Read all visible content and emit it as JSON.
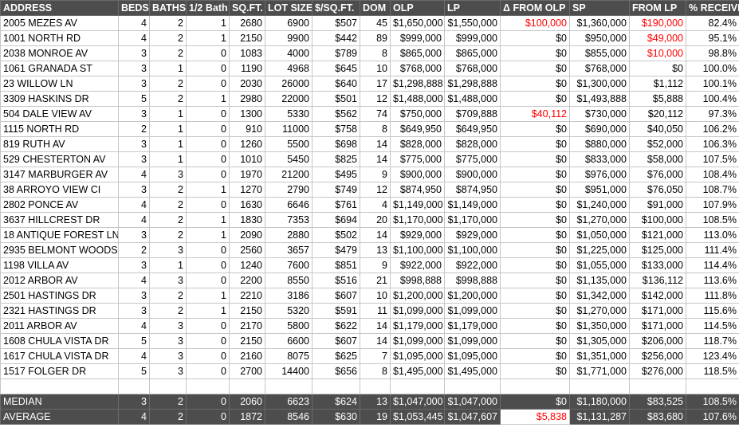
{
  "headers": [
    "ADDRESS",
    "BEDS",
    "BATHS",
    "1/2 Bath",
    "SQ.FT.",
    "LOT SIZE",
    "$/SQ.FT.",
    "DOM",
    "OLP",
    "LP",
    "Δ FROM OLP",
    "SP",
    "FROM LP",
    "% RECEIVED"
  ],
  "rows": [
    [
      "2005 MEZES AV",
      "4",
      "2",
      "1",
      "2680",
      "6900",
      "$507",
      "45",
      "$1,650,000",
      "$1,550,000",
      "$100,000",
      "$1,360,000",
      "$190,000",
      "82.4%"
    ],
    [
      "1001 NORTH RD",
      "4",
      "2",
      "1",
      "2150",
      "9900",
      "$442",
      "89",
      "$999,000",
      "$999,000",
      "$0",
      "$950,000",
      "$49,000",
      "95.1%"
    ],
    [
      "2038 MONROE AV",
      "3",
      "2",
      "0",
      "1083",
      "4000",
      "$789",
      "8",
      "$865,000",
      "$865,000",
      "$0",
      "$855,000",
      "$10,000",
      "98.8%"
    ],
    [
      "1061 GRANADA ST",
      "3",
      "1",
      "0",
      "1190",
      "4968",
      "$645",
      "10",
      "$768,000",
      "$768,000",
      "$0",
      "$768,000",
      "$0",
      "100.0%"
    ],
    [
      "23 WILLOW LN",
      "3",
      "2",
      "0",
      "2030",
      "26000",
      "$640",
      "17",
      "$1,298,888",
      "$1,298,888",
      "$0",
      "$1,300,000",
      "$1,112",
      "100.1%"
    ],
    [
      "3309 HASKINS DR",
      "5",
      "2",
      "1",
      "2980",
      "22000",
      "$501",
      "12",
      "$1,488,000",
      "$1,488,000",
      "$0",
      "$1,493,888",
      "$5,888",
      "100.4%"
    ],
    [
      "504 DALE VIEW AV",
      "3",
      "1",
      "0",
      "1300",
      "5330",
      "$562",
      "74",
      "$750,000",
      "$709,888",
      "$40,112",
      "$730,000",
      "$20,112",
      "97.3%"
    ],
    [
      "1115 NORTH RD",
      "2",
      "1",
      "0",
      "910",
      "11000",
      "$758",
      "8",
      "$649,950",
      "$649,950",
      "$0",
      "$690,000",
      "$40,050",
      "106.2%"
    ],
    [
      "819 RUTH AV",
      "3",
      "1",
      "0",
      "1260",
      "5500",
      "$698",
      "14",
      "$828,000",
      "$828,000",
      "$0",
      "$880,000",
      "$52,000",
      "106.3%"
    ],
    [
      "529 CHESTERTON AV",
      "3",
      "1",
      "0",
      "1010",
      "5450",
      "$825",
      "14",
      "$775,000",
      "$775,000",
      "$0",
      "$833,000",
      "$58,000",
      "107.5%"
    ],
    [
      "3147 MARBURGER AV",
      "4",
      "3",
      "0",
      "1970",
      "21200",
      "$495",
      "9",
      "$900,000",
      "$900,000",
      "$0",
      "$976,000",
      "$76,000",
      "108.4%"
    ],
    [
      "38 ARROYO VIEW CI",
      "3",
      "2",
      "1",
      "1270",
      "2790",
      "$749",
      "12",
      "$874,950",
      "$874,950",
      "$0",
      "$951,000",
      "$76,050",
      "108.7%"
    ],
    [
      "2802 PONCE AV",
      "4",
      "2",
      "0",
      "1630",
      "6646",
      "$761",
      "4",
      "$1,149,000",
      "$1,149,000",
      "$0",
      "$1,240,000",
      "$91,000",
      "107.9%"
    ],
    [
      "3637 HILLCREST DR",
      "4",
      "2",
      "1",
      "1830",
      "7353",
      "$694",
      "20",
      "$1,170,000",
      "$1,170,000",
      "$0",
      "$1,270,000",
      "$100,000",
      "108.5%"
    ],
    [
      "18 ANTIQUE FOREST LN",
      "3",
      "2",
      "1",
      "2090",
      "2880",
      "$502",
      "14",
      "$929,000",
      "$929,000",
      "$0",
      "$1,050,000",
      "$121,000",
      "113.0%"
    ],
    [
      "2935 BELMONT WOODS",
      "2",
      "3",
      "0",
      "2560",
      "3657",
      "$479",
      "13",
      "$1,100,000",
      "$1,100,000",
      "$0",
      "$1,225,000",
      "$125,000",
      "111.4%"
    ],
    [
      "1198 VILLA AV",
      "3",
      "1",
      "0",
      "1240",
      "7600",
      "$851",
      "9",
      "$922,000",
      "$922,000",
      "$0",
      "$1,055,000",
      "$133,000",
      "114.4%"
    ],
    [
      "2012 ARBOR AV",
      "4",
      "3",
      "0",
      "2200",
      "8550",
      "$516",
      "21",
      "$998,888",
      "$998,888",
      "$0",
      "$1,135,000",
      "$136,112",
      "113.6%"
    ],
    [
      "2501 HASTINGS DR",
      "3",
      "2",
      "1",
      "2210",
      "3186",
      "$607",
      "10",
      "$1,200,000",
      "$1,200,000",
      "$0",
      "$1,342,000",
      "$142,000",
      "111.8%"
    ],
    [
      "2321 HASTINGS DR",
      "3",
      "2",
      "1",
      "2150",
      "5320",
      "$591",
      "11",
      "$1,099,000",
      "$1,099,000",
      "$0",
      "$1,270,000",
      "$171,000",
      "115.6%"
    ],
    [
      "2011 ARBOR AV",
      "4",
      "3",
      "0",
      "2170",
      "5800",
      "$622",
      "14",
      "$1,179,000",
      "$1,179,000",
      "$0",
      "$1,350,000",
      "$171,000",
      "114.5%"
    ],
    [
      "1608 CHULA VISTA DR",
      "5",
      "3",
      "0",
      "2150",
      "6600",
      "$607",
      "14",
      "$1,099,000",
      "$1,099,000",
      "$0",
      "$1,305,000",
      "$206,000",
      "118.7%"
    ],
    [
      "1617 CHULA VISTA DR",
      "4",
      "3",
      "0",
      "2160",
      "8075",
      "$625",
      "7",
      "$1,095,000",
      "$1,095,000",
      "$0",
      "$1,351,000",
      "$256,000",
      "123.4%"
    ],
    [
      "1517 FOLGER DR",
      "5",
      "3",
      "0",
      "2700",
      "14400",
      "$656",
      "8",
      "$1,495,000",
      "$1,495,000",
      "$0",
      "$1,771,000",
      "$276,000",
      "118.5%"
    ]
  ],
  "negative_cells": [
    [
      0,
      10
    ],
    [
      0,
      12
    ],
    [
      1,
      12
    ],
    [
      2,
      12
    ],
    [
      6,
      10
    ]
  ],
  "summary": [
    [
      "MEDIAN",
      "3",
      "2",
      "0",
      "2060",
      "6623",
      "$624",
      "13",
      "$1,047,000",
      "$1,047,000",
      "$0",
      "$1,180,000",
      "$83,525",
      "108.5%"
    ],
    [
      "AVERAGE",
      "4",
      "2",
      "0",
      "1872",
      "8546",
      "$630",
      "19",
      "$1,053,445",
      "$1,047,607",
      "$5,838",
      "$1,131,287",
      "$83,680",
      "107.6%"
    ]
  ],
  "highlight_cells": [
    [
      1,
      10
    ]
  ],
  "colors": {
    "header_bg": "#4d4d4d",
    "header_text": "#ffffff",
    "negative_text": "#ff0000",
    "grid": "#c6c6c6"
  }
}
